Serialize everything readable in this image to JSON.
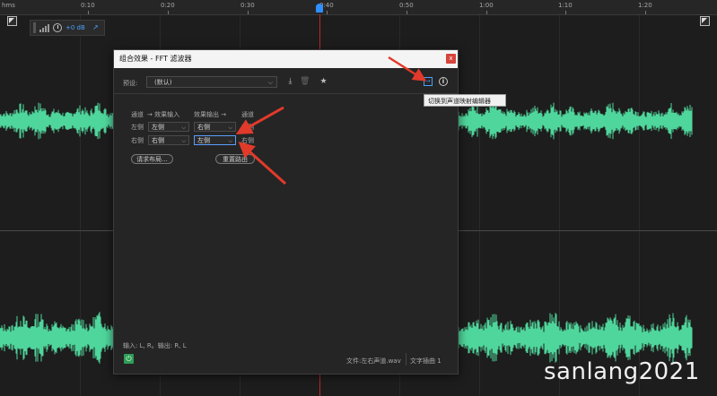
{
  "ruler": {
    "labels": [
      {
        "text": "hms",
        "pos": 0.003
      },
      {
        "text": "0:10",
        "pos": 0.113
      },
      {
        "text": "0:20",
        "pos": 0.224
      },
      {
        "text": "0:30",
        "pos": 0.335
      },
      {
        "text": "0:40",
        "pos": 0.446
      },
      {
        "text": "0:50",
        "pos": 0.557
      },
      {
        "text": "1:00",
        "pos": 0.668
      },
      {
        "text": "1:10",
        "pos": 0.779
      },
      {
        "text": "1:20",
        "pos": 0.89
      }
    ]
  },
  "hud": {
    "gain": "+0 dB"
  },
  "dialog": {
    "title": "组合效果 - FFT 滤波器",
    "close_label": "x",
    "preset_label": "预设:",
    "preset_value": "(默认)",
    "tooltip": "切换到声道映射编辑器",
    "headers": {
      "channel_left": "通道",
      "effect_input": "→ 效果输入",
      "effect_output": "效果输出 →",
      "channel_right": "通道"
    },
    "rows": [
      {
        "label": "左侧",
        "input": "左侧",
        "output": "右侧",
        "target": "左侧"
      },
      {
        "label": "右侧",
        "input": "右侧",
        "output": "左侧",
        "target": "右侧"
      }
    ],
    "request_layout_button": "请求布局...",
    "reset_routing_button": "重置路由",
    "footer_info": "输入: L, R。输出: R, L",
    "status_file": "文件:左右声道.wav",
    "status_track": "文字插曲 1"
  },
  "watermark": "sanlang2021",
  "colors": {
    "waveform": "#4fd69c",
    "playhead": "#c0282d",
    "accent": "#4aa0ff",
    "annotation_arrow": "#e23a2a"
  }
}
